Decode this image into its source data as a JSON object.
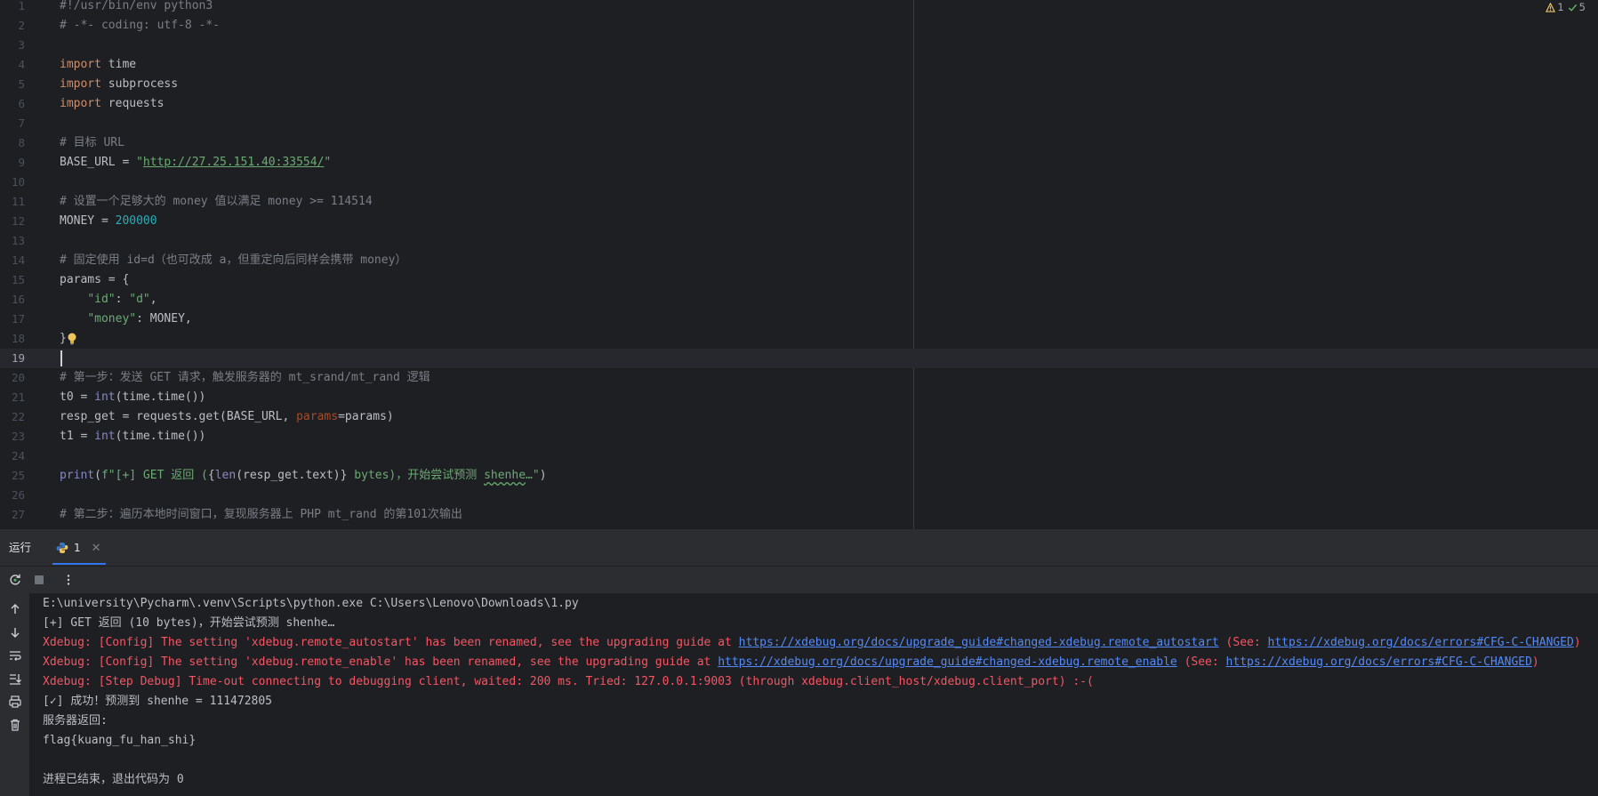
{
  "editor": {
    "inspections": {
      "warnings": "1",
      "ok": "5"
    },
    "lines": [
      {
        "n": "1",
        "tokens": [
          [
            "cm",
            "#!/usr/bin/env python3"
          ]
        ]
      },
      {
        "n": "2",
        "tokens": [
          [
            "cm",
            "# -*- coding: utf-8 -*-"
          ]
        ]
      },
      {
        "n": "3",
        "tokens": []
      },
      {
        "n": "4",
        "tokens": [
          [
            "kw",
            "import"
          ],
          [
            "p",
            " time"
          ]
        ]
      },
      {
        "n": "5",
        "tokens": [
          [
            "kw",
            "import"
          ],
          [
            "p",
            " subprocess"
          ]
        ]
      },
      {
        "n": "6",
        "tokens": [
          [
            "kw",
            "import"
          ],
          [
            "p",
            " requests"
          ]
        ]
      },
      {
        "n": "7",
        "tokens": []
      },
      {
        "n": "8",
        "tokens": [
          [
            "cm",
            "# 目标 URL"
          ]
        ]
      },
      {
        "n": "9",
        "tokens": [
          [
            "p",
            "BASE_URL = "
          ],
          [
            "str",
            "\""
          ],
          [
            "url",
            "http://27.25.151.40:33554/"
          ],
          [
            "str",
            "\""
          ]
        ]
      },
      {
        "n": "10",
        "tokens": []
      },
      {
        "n": "11",
        "tokens": [
          [
            "cm",
            "# 设置一个足够大的 money 值以满足 money >= 114514"
          ]
        ]
      },
      {
        "n": "12",
        "tokens": [
          [
            "p",
            "MONEY = "
          ],
          [
            "num",
            "200000"
          ]
        ]
      },
      {
        "n": "13",
        "tokens": []
      },
      {
        "n": "14",
        "tokens": [
          [
            "cm",
            "# 固定使用 id=d（也可改成 a，但重定向后同样会携带 money）"
          ]
        ]
      },
      {
        "n": "15",
        "tokens": [
          [
            "p",
            "params = {"
          ]
        ]
      },
      {
        "n": "16",
        "tokens": [
          [
            "p",
            "    "
          ],
          [
            "str",
            "\"id\""
          ],
          [
            "p",
            ": "
          ],
          [
            "str",
            "\"d\""
          ],
          [
            "p",
            ","
          ]
        ]
      },
      {
        "n": "17",
        "tokens": [
          [
            "p",
            "    "
          ],
          [
            "str",
            "\"money\""
          ],
          [
            "p",
            ": MONEY,"
          ]
        ]
      },
      {
        "n": "18",
        "tokens": [
          [
            "p",
            "}"
          ]
        ],
        "bulb": true
      },
      {
        "n": "19",
        "tokens": [],
        "caret": true
      },
      {
        "n": "20",
        "tokens": [
          [
            "cm",
            "# 第一步：发送 GET 请求，触发服务器的 mt_srand/mt_rand 逻辑"
          ]
        ]
      },
      {
        "n": "21",
        "tokens": [
          [
            "p",
            "t0 = "
          ],
          [
            "bi",
            "int"
          ],
          [
            "p",
            "(time.time())"
          ]
        ]
      },
      {
        "n": "22",
        "tokens": [
          [
            "p",
            "resp_get = requests.get(BASE_URL, "
          ],
          [
            "param",
            "params"
          ],
          [
            "p",
            "=params)"
          ]
        ]
      },
      {
        "n": "23",
        "tokens": [
          [
            "p",
            "t1 = "
          ],
          [
            "bi",
            "int"
          ],
          [
            "p",
            "(time.time())"
          ]
        ]
      },
      {
        "n": "24",
        "tokens": []
      },
      {
        "n": "25",
        "tokens": [
          [
            "bi",
            "print"
          ],
          [
            "p",
            "("
          ],
          [
            "str",
            "f\"[+] GET 返回 ("
          ],
          [
            "p",
            "{"
          ],
          [
            "bi",
            "len"
          ],
          [
            "p",
            "(resp_get.text)}"
          ],
          [
            "str",
            " bytes)，开始尝试预测 "
          ],
          [
            "typo",
            "shenhe"
          ],
          [
            "str",
            "…\""
          ],
          [
            "p",
            ")"
          ]
        ]
      },
      {
        "n": "26",
        "tokens": []
      },
      {
        "n": "27",
        "tokens": [
          [
            "cm",
            "# 第二步：遍历本地时间窗口，复现服务器上 PHP mt_rand 的第101次输出"
          ]
        ]
      }
    ]
  },
  "run": {
    "title": "运行",
    "tab_label": "1",
    "console": [
      {
        "type": "normal",
        "parts": [
          [
            "t",
            "E:\\university\\Pycharm\\.venv\\Scripts\\python.exe C:\\Users\\Lenovo\\Downloads\\1.py"
          ]
        ]
      },
      {
        "type": "normal",
        "parts": [
          [
            "t",
            "[+] GET 返回 (10 bytes)，开始尝试预测 shenhe…"
          ]
        ]
      },
      {
        "type": "err",
        "parts": [
          [
            "t",
            "Xdebug: [Config] The setting 'xdebug.remote_autostart' has been renamed, see the upgrading guide at "
          ],
          [
            "a",
            "https://xdebug.org/docs/upgrade_guide#changed-xdebug.remote_autostart"
          ],
          [
            "t",
            " (See: "
          ],
          [
            "a",
            "https://xdebug.org/docs/errors#CFG-C-CHANGED"
          ],
          [
            "t",
            ")"
          ]
        ]
      },
      {
        "type": "err",
        "parts": [
          [
            "t",
            "Xdebug: [Config] The setting 'xdebug.remote_enable' has been renamed, see the upgrading guide at "
          ],
          [
            "a",
            "https://xdebug.org/docs/upgrade_guide#changed-xdebug.remote_enable"
          ],
          [
            "t",
            " (See: "
          ],
          [
            "a",
            "https://xdebug.org/docs/errors#CFG-C-CHANGED"
          ],
          [
            "t",
            ")"
          ]
        ]
      },
      {
        "type": "err",
        "parts": [
          [
            "t",
            "Xdebug: [Step Debug] Time-out connecting to debugging client, waited: 200 ms. Tried: 127.0.0.1:9003 (through xdebug.client_host/xdebug.client_port) :-("
          ]
        ]
      },
      {
        "type": "normal",
        "parts": [
          [
            "t",
            "[✓] 成功！预测到 shenhe = 111472805"
          ]
        ]
      },
      {
        "type": "normal",
        "parts": [
          [
            "t",
            "服务器返回:"
          ]
        ]
      },
      {
        "type": "normal",
        "parts": [
          [
            "t",
            "flag{kuang_fu_han_shi}"
          ]
        ]
      },
      {
        "type": "normal",
        "parts": []
      },
      {
        "type": "normal",
        "parts": [
          [
            "t",
            "进程已结束，退出代码为 0"
          ]
        ]
      }
    ]
  },
  "colors": {
    "background": "#1e1f22",
    "panel": "#2b2d30",
    "keyword": "#cf8e6d",
    "comment": "#7a7e85",
    "string": "#6aab73",
    "number": "#2aacb8",
    "error": "#f75464",
    "link": "#548af7",
    "accent": "#3574f0"
  },
  "icons": {
    "warning": "warning-triangle-icon",
    "ok": "checkmark-icon",
    "bulb": "lightbulb-icon",
    "rerun": "rerun-icon",
    "stop": "stop-icon",
    "more": "more-vertical-icon",
    "python": "python-icon",
    "close": "close-icon"
  }
}
